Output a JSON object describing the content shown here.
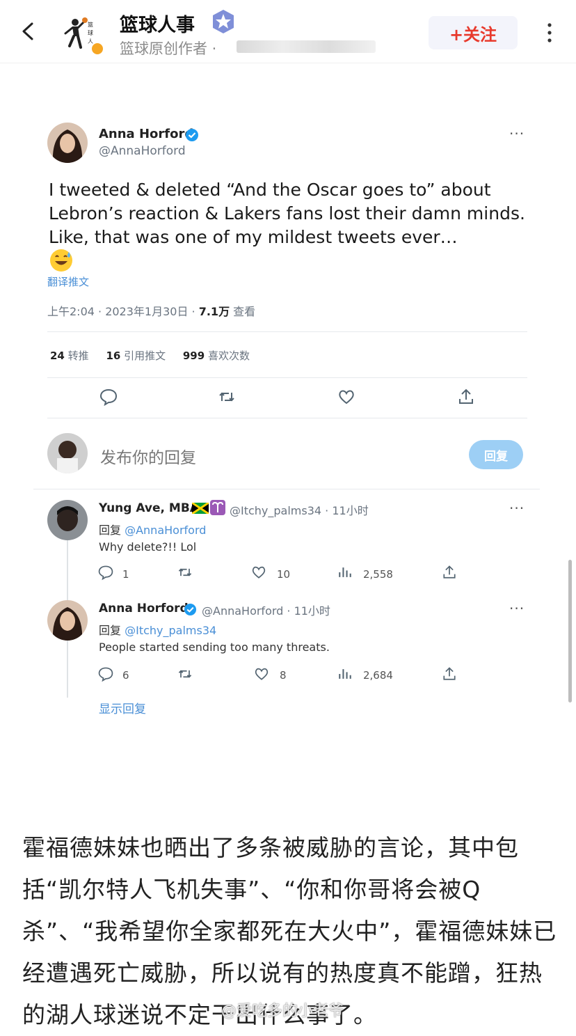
{
  "header": {
    "account_name": "篮球人事",
    "account_sub": "篮球原创作者 · ",
    "follow_label": "+关注"
  },
  "tweet": {
    "author_name": "Anna Horford",
    "author_handle": "@AnnaHorford",
    "more": "···",
    "text": "I tweeted & deleted “And the Oscar goes to” about Lebron’s reaction & Lakers fans lost their damn minds. Like, that was one of my mildest tweets ever…",
    "translate_label": "翻译推文",
    "time": "上午2:04 · 2023年1月30日 · ",
    "views_count": "7.1万",
    "views_label": " 查看",
    "stats": [
      {
        "count": "24",
        "label": " 转推"
      },
      {
        "count": "16",
        "label": " 引用推文"
      },
      {
        "count": "999",
        "label": " 喜欢次数"
      }
    ],
    "reply_placeholder": "发布你的回复",
    "reply_button": "回复"
  },
  "replies": [
    {
      "name": "Yung Ave, MBA",
      "handle_time": "@Itchy_palms34 · 11小时",
      "reply_prefix": "回复 ",
      "reply_to": "@AnnaHorford",
      "text": "Why delete?!! Lol",
      "comments": "1",
      "retweets": "",
      "likes": "10",
      "views": "2,558"
    },
    {
      "name": "Anna Horford",
      "handle_time": "@AnnaHorford · 11小时",
      "reply_prefix": "回复 ",
      "reply_to": "@Itchy_palms34",
      "text": "People started sending too many threats.",
      "comments": "6",
      "retweets": "",
      "likes": "8",
      "views": "2,684"
    }
  ],
  "show_replies": "显示回复",
  "article": {
    "paragraph": "霍福德妹妹也晒出了多条被威胁的言论，其中包括“凯尔特人飞机失事”、“你和你哥将会被Q杀”、“我希望你全家都死在大火中”，霍福德妹妹已经遭遇死亡威胁，所以说有的热度真不能蹭，狂热的湖人球迷说不定干出什么事了。"
  },
  "watermark": "@爱吃多的小老爷",
  "colors": {
    "accent_red": "#e8392c",
    "link_blue": "#4a8fd6",
    "reply_btn": "#9dcff5"
  }
}
